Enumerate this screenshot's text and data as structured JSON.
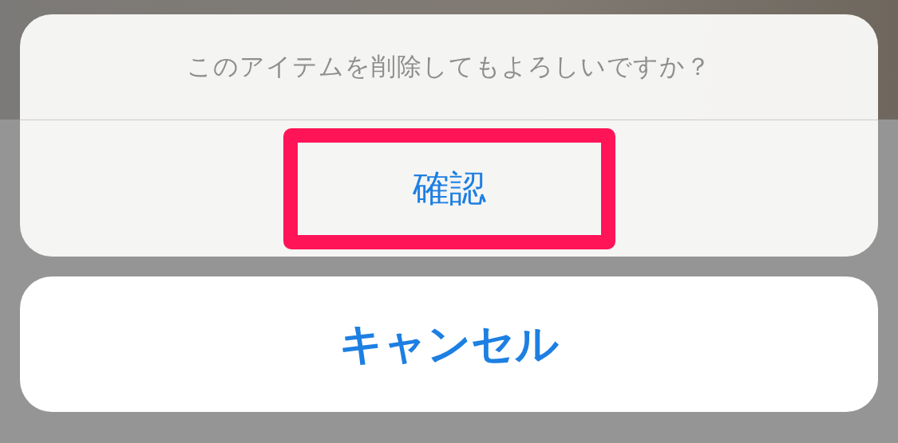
{
  "action_sheet": {
    "message": "このアイテムを削除してもよろしいですか？",
    "actions": [
      {
        "label": "確認",
        "highlighted": true
      }
    ]
  },
  "cancel_button": {
    "label": "キャンセル"
  }
}
